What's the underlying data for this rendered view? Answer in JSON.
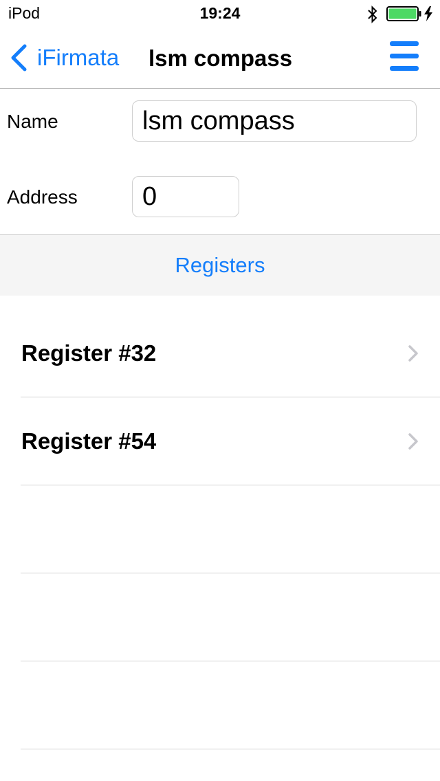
{
  "status_bar": {
    "carrier": "iPod",
    "time": "19:24",
    "bluetooth_icon": "bluetooth-icon",
    "battery_icon": "battery-charging-icon"
  },
  "nav": {
    "back_label": "iFirmata",
    "title": "lsm compass",
    "menu_icon": "hamburger-menu-icon"
  },
  "form": {
    "name_label": "Name",
    "name_value": "lsm compass",
    "address_label": "Address",
    "address_value": "0"
  },
  "section": {
    "title": "Registers"
  },
  "registers": [
    {
      "label": "Register #32"
    },
    {
      "label": "Register #54"
    }
  ],
  "colors": {
    "accent": "#147efb",
    "battery_fill": "#4cd964",
    "separator": "#d2d2d2",
    "section_bg": "#f5f5f5"
  }
}
